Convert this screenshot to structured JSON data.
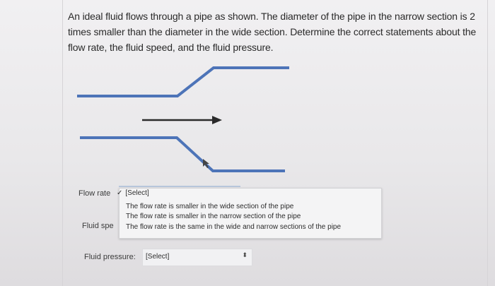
{
  "question": {
    "lines": [
      "An ideal fluid flows through a pipe as shown. The diameter of the pipe in the narrow section is 2",
      "times smaller than the diameter in the wide section. Determine the correct statements about the",
      "flow rate, the fluid speed, and the fluid pressure."
    ]
  },
  "diagram": {
    "pipe_color": "#4d74b8",
    "arrow_color": "#2a2a2a"
  },
  "fields": {
    "flow_rate": {
      "label": "Flow rate",
      "selected": "[Select]",
      "check_icon": "✓",
      "options": [
        "The flow rate is smaller in the wide section of the pipe",
        "The flow rate is smaller in the narrow section of the pipe",
        "The flow rate is the same in the wide and narrow sections of the pipe"
      ]
    },
    "fluid_speed": {
      "label": "Fluid spe"
    },
    "fluid_pressure": {
      "label": "Fluid pressure:",
      "selected": "[Select]",
      "arrows_icon": "⬍"
    }
  }
}
